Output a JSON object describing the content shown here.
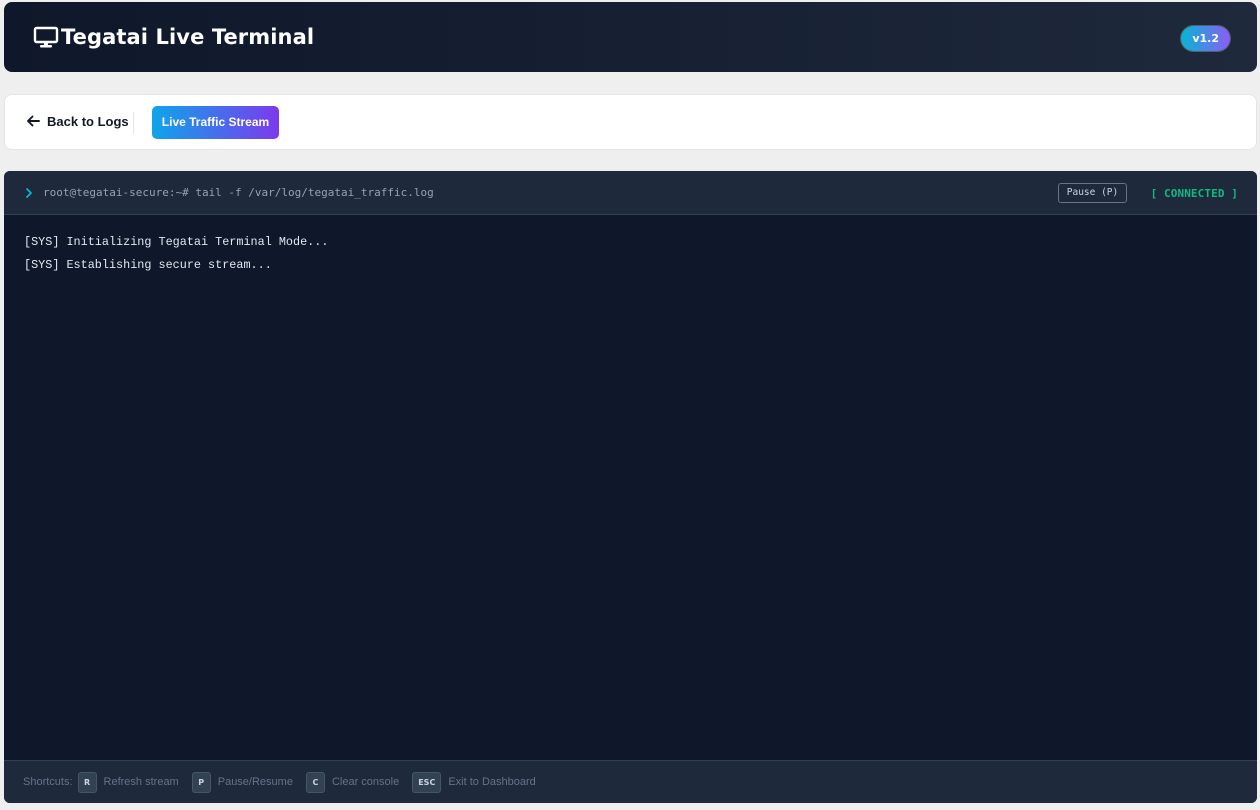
{
  "header": {
    "title": "Tegatai Live Terminal",
    "icon": "monitor-icon",
    "version": "v1.2"
  },
  "nav": {
    "back_label": "Back to Logs",
    "back_icon": "arrow-left-icon",
    "live_label": "Live Traffic Stream"
  },
  "terminal": {
    "prompt": "root@tegatai-secure:~# tail -f /var/log/tegatai_traffic.log",
    "pause_label": "Pause (P)",
    "status": "[ CONNECTED ]",
    "lines": [
      "[SYS] Initializing Tegatai Terminal Mode...",
      "[SYS] Establishing secure stream..."
    ]
  },
  "shortcuts": {
    "label": "Shortcuts:",
    "items": [
      {
        "key": "R",
        "desc": "Refresh stream"
      },
      {
        "key": "P",
        "desc": "Pause/Resume"
      },
      {
        "key": "C",
        "desc": "Clear console"
      },
      {
        "key": "ESC",
        "desc": "Exit to Dashboard"
      }
    ]
  },
  "colors": {
    "accent_start": "#0ea5e9",
    "accent_end": "#7c3aed",
    "status_connected": "#10b981",
    "terminal_bg": "#0f172a"
  }
}
